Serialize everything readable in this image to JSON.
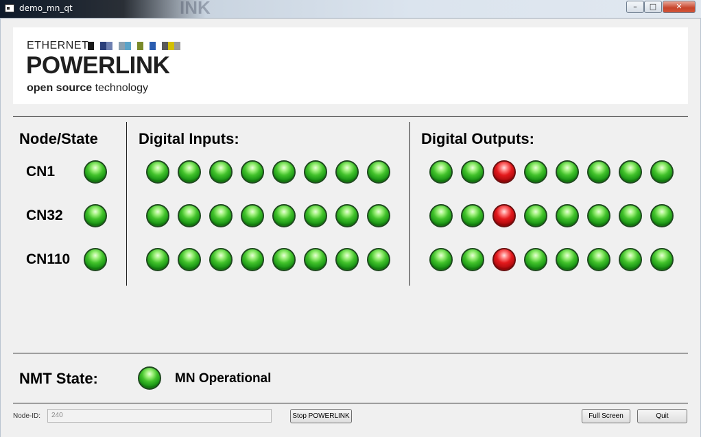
{
  "window": {
    "title": "demo_mn_qt",
    "ghost_text": "INK",
    "controls": {
      "minimize": "–",
      "maximize": "□",
      "close": "✕"
    }
  },
  "logo": {
    "line1": "ETHERNET",
    "line2": "POWERLINK",
    "line3_bold": "open source",
    "line3_rest": " technology",
    "bar_colors": [
      "#1a1a1a",
      "#ffffff",
      "#2b3f7a",
      "#6d7fb0",
      "#ffffff",
      "#8aa0b0",
      "#5aa3c8",
      "#ffffff",
      "#7a8a2a",
      "#ffffff",
      "#2a5db0",
      "#ffffff",
      "#5a5a5a",
      "#d4c000",
      "#9a9a9a"
    ]
  },
  "headings": {
    "node_state": "Node/State",
    "digital_inputs": "Digital Inputs:",
    "digital_outputs": "Digital Outputs:"
  },
  "nodes": [
    {
      "label": "CN1",
      "state": "green",
      "inputs": [
        "green",
        "green",
        "green",
        "green",
        "green",
        "green",
        "green",
        "green"
      ],
      "outputs": [
        "green",
        "green",
        "red",
        "green",
        "green",
        "green",
        "green",
        "green"
      ]
    },
    {
      "label": "CN32",
      "state": "green",
      "inputs": [
        "green",
        "green",
        "green",
        "green",
        "green",
        "green",
        "green",
        "green"
      ],
      "outputs": [
        "green",
        "green",
        "red",
        "green",
        "green",
        "green",
        "green",
        "green"
      ]
    },
    {
      "label": "CN110",
      "state": "green",
      "inputs": [
        "green",
        "green",
        "green",
        "green",
        "green",
        "green",
        "green",
        "green"
      ],
      "outputs": [
        "green",
        "green",
        "red",
        "green",
        "green",
        "green",
        "green",
        "green"
      ]
    }
  ],
  "nmt": {
    "label": "NMT State:",
    "state": "green",
    "text": "MN Operational"
  },
  "footer": {
    "node_id_label": "Node-ID:",
    "node_id_value": "240",
    "stop_button": "Stop POWERLINK",
    "fullscreen_button": "Full Screen",
    "quit_button": "Quit"
  },
  "colors": {
    "led_on": "#2fb624",
    "led_alarm": "#e3191c"
  }
}
